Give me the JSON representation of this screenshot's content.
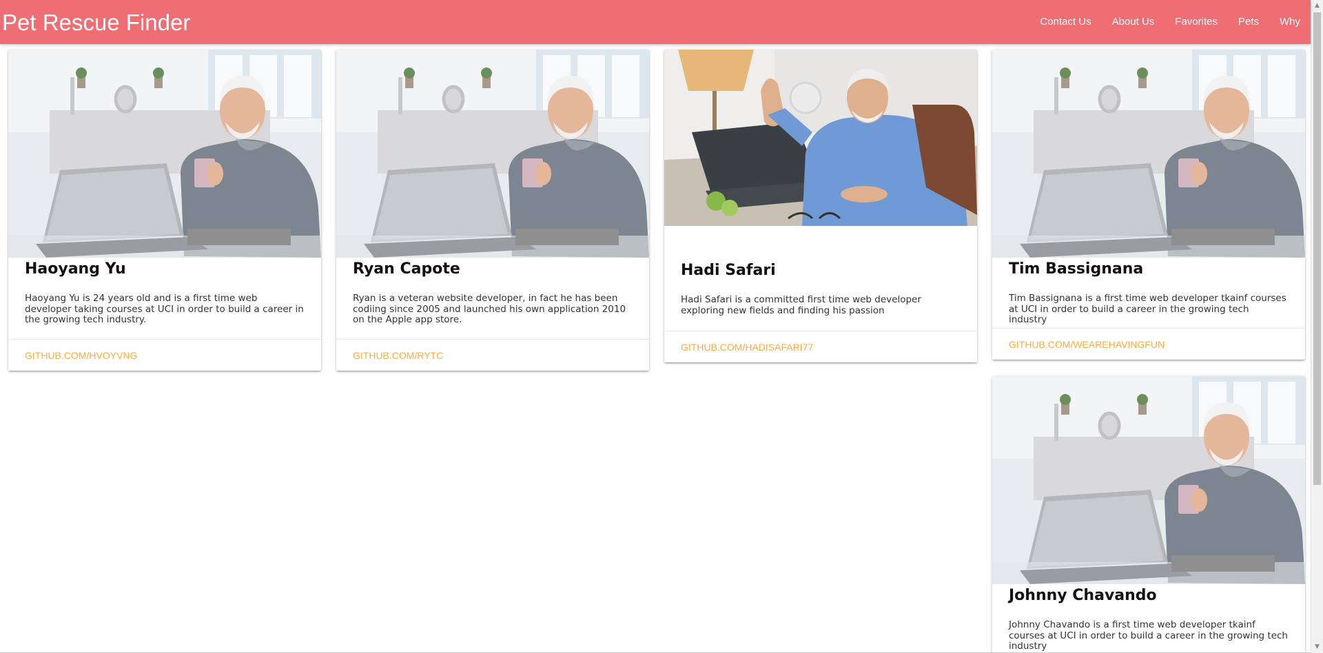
{
  "navbar": {
    "brand": "Pet Rescue Finder",
    "links": [
      "Contact Us",
      "About Us",
      "Favorites",
      "Pets",
      "Why"
    ]
  },
  "cards": [
    {
      "name": "Haoyang Yu",
      "description": "Haoyang Yu is 24 years old and is a first time web developer taking courses at UCI in order to build a career in the growing tech industry.",
      "link": "GITHUB.COM/HVOYVNG",
      "image": "man-with-laptop-and-mug"
    },
    {
      "name": "Ryan Capote",
      "description": "Ryan is a veteran website developer, in fact he has been codiing since 2005 and launched his own application 2010 on the Apple app store.",
      "link": "GITHUB.COM/RYTC",
      "image": "man-with-laptop-and-mug"
    },
    {
      "name": "Hadi Safari",
      "description": "Hadi Safari is a committed first time web developer exploring new fields and finding his passion",
      "link": "GITHUB.COM/HADISAFARI77",
      "image": "man-thumbs-up-at-desk"
    },
    {
      "name": "Tim Bassignana",
      "description": "Tim Bassignana is a first time web developer tkainf courses at UCI in order to build a career in the growing tech industry",
      "link": "GITHUB.COM/WEAREHAVINGFUN",
      "image": "man-with-laptop-and-mug"
    },
    {
      "name": "Johnny Chavando",
      "description": "Johnny Chavando is a first time web developer tkainf courses at UCI in order to build a career in the growing tech industry",
      "link": "",
      "image": "man-with-laptop-and-mug"
    }
  ],
  "colors": {
    "navbar": "#ee6e73",
    "link": "#ffab40"
  }
}
